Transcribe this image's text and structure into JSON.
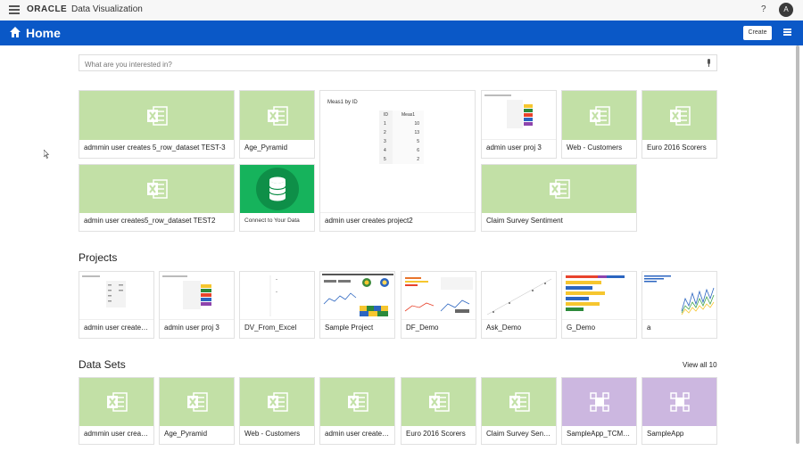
{
  "topbar": {
    "oracle": "ORACLE",
    "app_name": "Data Visualization",
    "help": "?",
    "avatar": "A"
  },
  "header": {
    "title": "Home",
    "create_label": "Create"
  },
  "search": {
    "placeholder": "What are you interested in?"
  },
  "recent": [
    {
      "label": "admmin user creates 5_row_dataset TEST-3",
      "type": "dataset",
      "icon": "excel-icon"
    },
    {
      "label": "Age_Pyramid",
      "type": "dataset",
      "icon": "excel-icon"
    },
    {
      "label": "admin user creates project2",
      "type": "project",
      "chart_title": "Meas1 by ID",
      "table_headers": [
        "ID",
        "Meas1"
      ],
      "table_rows": [
        [
          "1",
          "10"
        ],
        [
          "2",
          "13"
        ],
        [
          "3",
          "5"
        ],
        [
          "4",
          "6"
        ],
        [
          "5",
          "2"
        ]
      ]
    },
    {
      "label": "admin user proj 3",
      "type": "project"
    },
    {
      "label": "Web - Customers",
      "type": "dataset",
      "icon": "excel-icon"
    },
    {
      "label": "Euro 2016 Scorers",
      "type": "dataset",
      "icon": "excel-icon"
    },
    {
      "label": "admin user creates5_row_dataset TEST2",
      "type": "dataset",
      "icon": "excel-icon"
    },
    {
      "label": "Connect to Your Data",
      "type": "connect",
      "icon": "database-icon"
    },
    {
      "label": "Claim Survey Sentiment",
      "type": "dataset",
      "icon": "excel-icon"
    }
  ],
  "projects": {
    "title": "Projects",
    "items": [
      "admin user create…",
      "admin user proj 3",
      "DV_From_Excel",
      "Sample Project",
      "DF_Demo",
      "Ask_Demo",
      "G_Demo",
      "a"
    ]
  },
  "datasets": {
    "title": "Data Sets",
    "view_all": "View all 10",
    "items": [
      {
        "label": "admmin user crea…",
        "kind": "excel"
      },
      {
        "label": "Age_Pyramid",
        "kind": "excel"
      },
      {
        "label": "Web - Customers",
        "kind": "excel"
      },
      {
        "label": "admin user create…",
        "kind": "excel"
      },
      {
        "label": "Euro 2016 Scorers",
        "kind": "excel"
      },
      {
        "label": "Claim Survey Sen…",
        "kind": "excel"
      },
      {
        "label": "SampleApp_TCM…",
        "kind": "subject-area"
      },
      {
        "label": "SampleApp",
        "kind": "subject-area"
      }
    ]
  },
  "colors": {
    "brand_blue": "#0a58c7",
    "dataset_green": "#c2e0a6",
    "subject_purple": "#ccb7e0",
    "connect_green": "#16b35c"
  }
}
